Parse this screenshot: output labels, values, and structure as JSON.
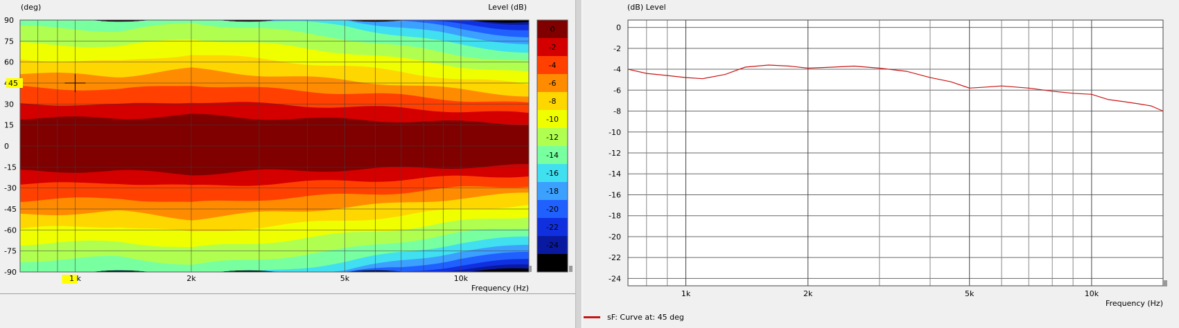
{
  "chart_data": [
    {
      "type": "heatmap",
      "ylabel": "(deg)",
      "xlabel": "Frequency  (Hz)",
      "colorbar_title": "Level  (dB)",
      "x_axis": {
        "scale": "log",
        "range": [
          720,
          15000
        ],
        "ticks": [
          {
            "value": 1000,
            "label": "1 k"
          },
          {
            "value": 2000,
            "label": "2k"
          },
          {
            "value": 5000,
            "label": "5k"
          },
          {
            "value": 10000,
            "label": "10k"
          }
        ]
      },
      "y_axis": {
        "range": [
          -90,
          90
        ],
        "ticks": [
          90,
          75,
          60,
          45,
          30,
          15,
          0,
          -15,
          -30,
          -45,
          -60,
          -75,
          -90
        ]
      },
      "grid": true,
      "cursor": {
        "frequency": 1000,
        "angle": 45
      },
      "y_marker_label": "45",
      "colorbar": {
        "levels": [
          {
            "label": "0",
            "color": "#800000"
          },
          {
            "label": "-2",
            "color": "#d40000"
          },
          {
            "label": "-4",
            "color": "#ff4000"
          },
          {
            "label": "-6",
            "color": "#ff8c00"
          },
          {
            "label": "-8",
            "color": "#ffd700"
          },
          {
            "label": "-10",
            "color": "#f0ff00"
          },
          {
            "label": "-12",
            "color": "#b0ff50"
          },
          {
            "label": "-14",
            "color": "#78ffa0"
          },
          {
            "label": "-16",
            "color": "#40e0f0"
          },
          {
            "label": "-18",
            "color": "#3ca0ff"
          },
          {
            "label": "-20",
            "color": "#2060ff"
          },
          {
            "label": "-22",
            "color": "#1030e0"
          },
          {
            "label": "-24",
            "color": "#0a1aa0"
          }
        ],
        "below_color": "#000000"
      },
      "contour_bounds_deg": {
        "x": [
          720,
          1000,
          1300,
          2000,
          3000,
          5000,
          7000,
          10000,
          15000
        ],
        "levels": [
          {
            "level": "0",
            "upper": [
              20,
              20,
              20,
              22,
              20,
              19,
              18,
              17,
              16
            ],
            "lower": [
              -18,
              -18,
              -18,
              -20,
              -18,
              -17,
              -16,
              -15,
              -14
            ]
          },
          {
            "level": "-2",
            "upper": [
              30,
              30,
              29,
              32,
              30,
              28,
              27,
              25,
              23
            ],
            "lower": [
              -27,
              -27,
              -26,
              -29,
              -27,
              -25,
              -24,
              -22,
              -21
            ]
          },
          {
            "level": "-4",
            "upper": [
              42,
              41,
              40,
              44,
              41,
              38,
              36,
              33,
              30
            ],
            "lower": [
              -39,
              -38,
              -37,
              -41,
              -38,
              -35,
              -33,
              -30,
              -28
            ]
          },
          {
            "level": "-6",
            "upper": [
              52,
              51,
              50,
              55,
              51,
              47,
              44,
              40,
              36
            ],
            "lower": [
              -49,
              -48,
              -47,
              -52,
              -48,
              -44,
              -41,
              -37,
              -34
            ]
          },
          {
            "level": "-8",
            "upper": [
              62,
              61,
              60,
              66,
              62,
              57,
              53,
              48,
              44
            ],
            "lower": [
              -59,
              -58,
              -57,
              -62,
              -58,
              -53,
              -50,
              -45,
              -42
            ]
          },
          {
            "level": "-10",
            "upper": [
              73,
              72,
              71,
              77,
              73,
              67,
              62,
              57,
              52
            ],
            "lower": [
              -70,
              -69,
              -68,
              -73,
              -69,
              -63,
              -59,
              -54,
              -50
            ]
          },
          {
            "level": "-12",
            "upper": [
              85,
              84,
              82,
              88,
              84,
              77,
              71,
              65,
              60
            ],
            "lower": [
              -82,
              -81,
              -79,
              -85,
              -81,
              -74,
              -68,
              -62,
              -58
            ]
          },
          {
            "level": "-14",
            "upper": [
              90,
              90,
              90,
              90,
              90,
              86,
              79,
              72,
              67
            ],
            "lower": [
              -90,
              -90,
              -90,
              -90,
              -90,
              -83,
              -76,
              -69,
              -65
            ]
          },
          {
            "level": "-16",
            "upper": [
              90,
              90,
              90,
              90,
              90,
              90,
              85,
              78,
              73
            ],
            "lower": [
              -90,
              -90,
              -90,
              -90,
              -90,
              -89,
              -82,
              -75,
              -71
            ]
          },
          {
            "level": "-18",
            "upper": [
              90,
              90,
              90,
              90,
              90,
              90,
              90,
              83,
              78
            ],
            "lower": [
              -90,
              -90,
              -90,
              -90,
              -90,
              -90,
              -87,
              -80,
              -76
            ]
          },
          {
            "level": "-20",
            "upper": [
              90,
              90,
              90,
              90,
              90,
              90,
              90,
              87,
              83
            ],
            "lower": [
              -90,
              -90,
              -90,
              -90,
              -90,
              -90,
              -90,
              -85,
              -81
            ]
          },
          {
            "level": "-22",
            "upper": [
              90,
              90,
              90,
              90,
              90,
              90,
              90,
              90,
              87
            ],
            "lower": [
              -90,
              -90,
              -90,
              -90,
              -90,
              -90,
              -90,
              -88,
              -85
            ]
          },
          {
            "level": "-24",
            "upper": [
              90,
              90,
              90,
              90,
              90,
              90,
              90,
              90,
              89
            ],
            "lower": [
              -90,
              -90,
              -90,
              -90,
              -90,
              -90,
              -90,
              -90,
              -88
            ]
          }
        ]
      }
    },
    {
      "type": "line",
      "ylabel": "(dB)  Level",
      "xlabel": "Frequency  (Hz)",
      "x_axis": {
        "scale": "log",
        "range": [
          720,
          15000
        ],
        "ticks": [
          {
            "value": 1000,
            "label": "1k"
          },
          {
            "value": 2000,
            "label": "2k"
          },
          {
            "value": 5000,
            "label": "5k"
          },
          {
            "value": 10000,
            "label": "10k"
          }
        ]
      },
      "ylim": [
        -24.7,
        0.7
      ],
      "y_ticks": [
        0,
        -2,
        -4,
        -6,
        -8,
        -10,
        -12,
        -14,
        -16,
        -18,
        -20,
        -22,
        -24
      ],
      "grid": true,
      "series": [
        {
          "name": "sF: Curve at: 45 deg",
          "color": "#c81414",
          "x": [
            720,
            800,
            900,
            1000,
            1100,
            1250,
            1400,
            1600,
            1800,
            2000,
            2300,
            2600,
            3000,
            3500,
            4000,
            4500,
            5000,
            5500,
            6000,
            7000,
            8000,
            9000,
            10000,
            11000,
            12000,
            13000,
            14000,
            15000
          ],
          "y": [
            -4.0,
            -4.4,
            -4.6,
            -4.8,
            -4.9,
            -4.5,
            -3.8,
            -3.6,
            -3.7,
            -3.9,
            -3.8,
            -3.7,
            -3.9,
            -4.2,
            -4.8,
            -5.2,
            -5.8,
            -5.7,
            -5.6,
            -5.8,
            -6.1,
            -6.3,
            -6.4,
            -6.9,
            -7.1,
            -7.3,
            -7.5,
            -8.0
          ]
        }
      ]
    }
  ],
  "legend": {
    "label": "sF: Curve at: 45 deg",
    "color": "#c81414"
  }
}
